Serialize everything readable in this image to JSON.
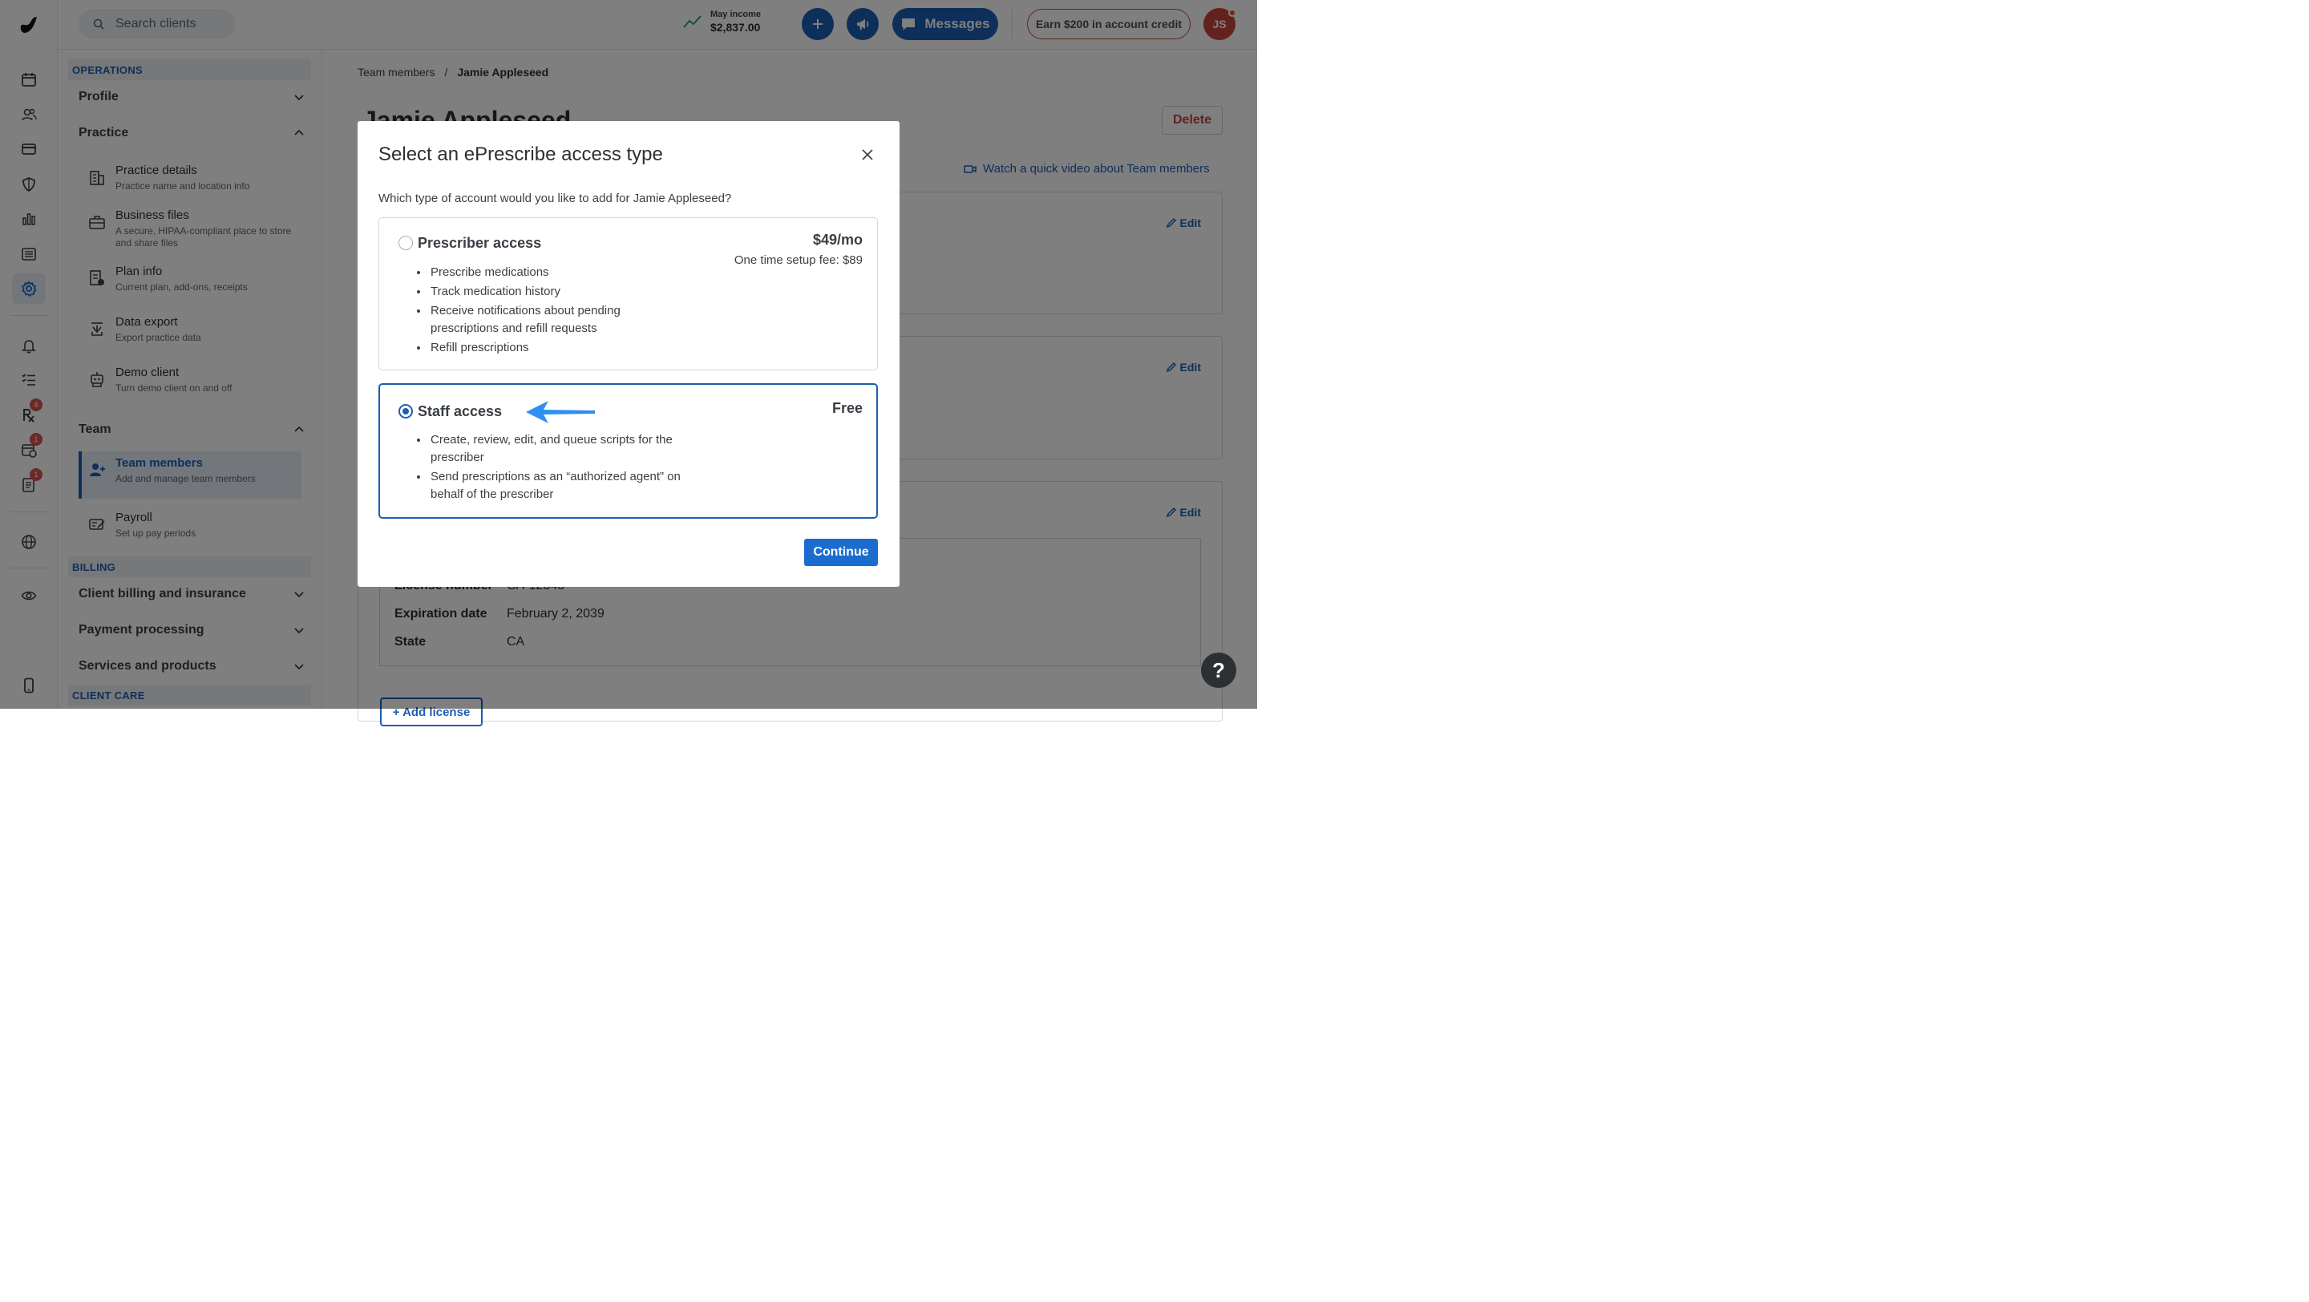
{
  "topbar": {
    "search_placeholder": "Search clients",
    "income_label": "May income",
    "income_value": "$2,837.00",
    "messages_label": "Messages",
    "earn_label": "Earn $200 in account credit",
    "avatar_initials": "JS"
  },
  "rail": {
    "badges": {
      "erx": "4",
      "calendar": "1",
      "docs": "1"
    }
  },
  "nav": {
    "operations_header": "OPERATIONS",
    "profile": "Profile",
    "practice": "Practice",
    "practice_items": [
      {
        "title": "Practice details",
        "sub": "Practice name and location info"
      },
      {
        "title": "Business files",
        "sub": "A secure, HIPAA-compliant place to store and share files"
      },
      {
        "title": "Plan info",
        "sub": "Current plan, add-ons, receipts"
      },
      {
        "title": "Data export",
        "sub": "Export practice data"
      },
      {
        "title": "Demo client",
        "sub": "Turn demo client on and off"
      }
    ],
    "team": "Team",
    "team_items": [
      {
        "title": "Team members",
        "sub": "Add and manage team members"
      },
      {
        "title": "Payroll",
        "sub": "Set up pay periods"
      }
    ],
    "billing_header": "BILLING",
    "billing_items": [
      "Client billing and insurance",
      "Payment processing",
      "Services and products"
    ],
    "client_care_header": "CLIENT CARE"
  },
  "main": {
    "breadcrumb_parent": "Team members",
    "breadcrumb_sep": "/",
    "breadcrumb_current": "Jamie Appleseed",
    "title": "Jamie Appleseed",
    "delete_label": "Delete",
    "watch_label": "Watch a quick video about Team members",
    "edit_label": "Edit",
    "license": {
      "number_label": "License number",
      "number_value": "CA-12345",
      "expiration_label": "Expiration date",
      "expiration_value": "February 2, 2039",
      "state_label": "State",
      "state_value": "CA"
    },
    "add_license_label": "+ Add license"
  },
  "modal": {
    "title": "Select an ePrescribe access type",
    "question": "Which type of account would you like to add for Jamie Appleseed?",
    "options": [
      {
        "name": "Prescriber access",
        "price": "$49/mo",
        "fee": "One time setup fee: $89",
        "selected": false,
        "features": [
          "Prescribe medications",
          "Track medication history",
          "Receive notifications about pending prescriptions and refill requests",
          "Refill prescriptions"
        ]
      },
      {
        "name": "Staff access",
        "price": "Free",
        "selected": true,
        "features": [
          "Create, review, edit, and queue scripts for the prescriber",
          "Send prescriptions as an “authorized agent” on behalf of the prescriber"
        ]
      }
    ],
    "continue_label": "Continue"
  },
  "help_label": "?",
  "colors": {
    "accent": "#1a5fb4",
    "danger": "#c9453c",
    "arrow": "#2f8ff0"
  }
}
